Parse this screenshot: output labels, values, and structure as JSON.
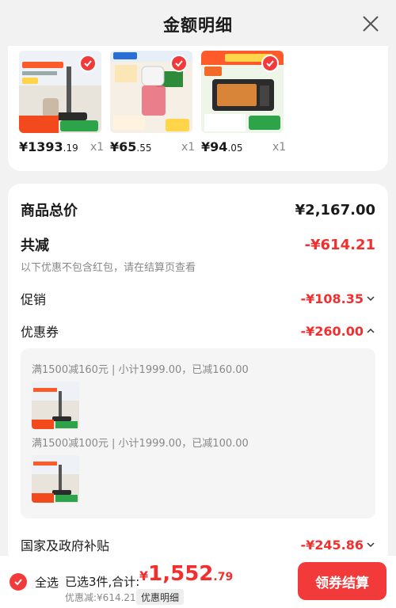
{
  "header": {
    "title": "金额明细"
  },
  "products": [
    {
      "price_int": "¥1393",
      "price_dec": ".19",
      "qty": "x1"
    },
    {
      "price_int": "¥65",
      "price_dec": ".55",
      "qty": "x1"
    },
    {
      "price_int": "¥94",
      "price_dec": ".05",
      "qty": "x1"
    }
  ],
  "summary": {
    "total_label": "商品总价",
    "total_value": "¥2,167.00",
    "reduce_label": "共减",
    "reduce_value": "-¥614.21",
    "reduce_note": "以下优惠不包含红包，请在结算页查看",
    "promo_label": "促销",
    "promo_value": "-¥108.35",
    "coupon_label": "优惠券",
    "coupon_value": "-¥260.00",
    "coupon_items": [
      {
        "text": "满1500减160元 | 小计1999.00，已减160.00"
      },
      {
        "text": "满1500减100元 | 小计1999.00，已减100.00"
      }
    ],
    "subsidy_label": "国家及政府补贴",
    "subsidy_value": "-¥245.86"
  },
  "bottom": {
    "select_all": "全选",
    "selected_info": "已选3件,合计:",
    "total_cur": "¥",
    "total_int": "1,552",
    "total_dec": ".79",
    "discount_note": "优惠减:¥614.21",
    "detail_chip": "优惠明细",
    "checkout": "领券结算"
  },
  "colors": {
    "accent": "#f23a3a",
    "price_red": "#f0302f"
  }
}
